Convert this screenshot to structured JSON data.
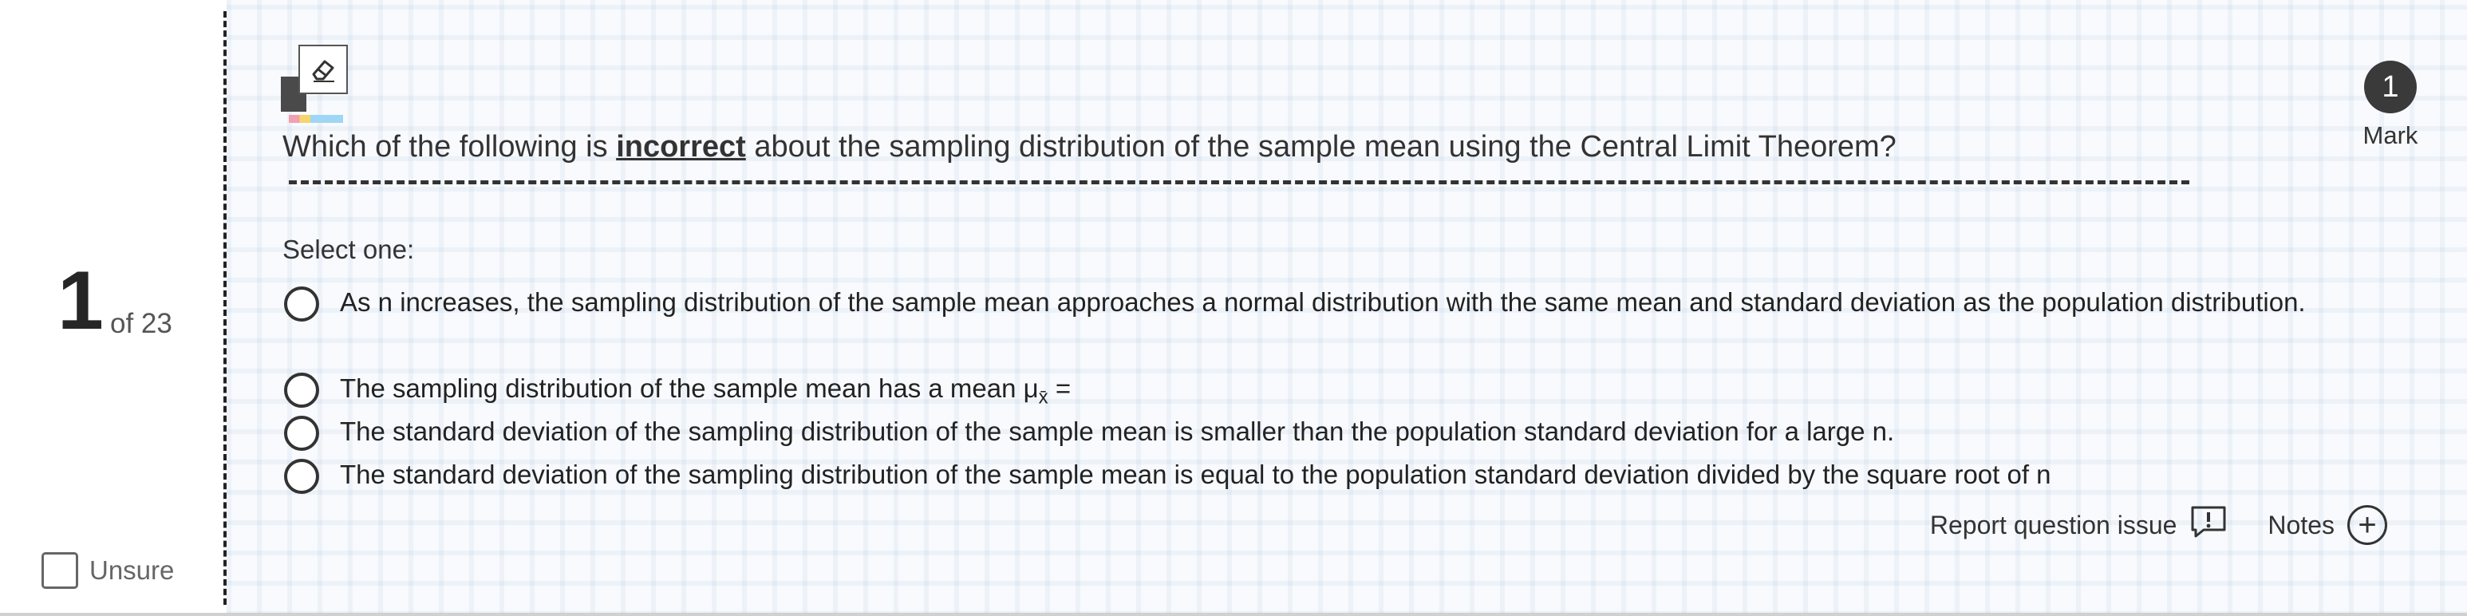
{
  "question_nav": {
    "number": "1",
    "of_total": "of 23"
  },
  "unsure": {
    "label": "Unsure"
  },
  "mark": {
    "value": "1",
    "label": "Mark"
  },
  "question": {
    "prefix": "Which of the following is ",
    "emphasis": "incorrect",
    "suffix": " about the sampling distribution of the sample mean using the Central Limit Theorem?"
  },
  "select_label": "Select one:",
  "options": [
    {
      "text": "As n increases, the sampling distribution of the sample mean approaches a normal distribution with the same mean and standard deviation as the population distribution."
    },
    {
      "text": "The sampling distribution of the sample mean has a mean ",
      "formula_symbol": "μ",
      "formula_sub": "x̄",
      "formula_tail": " ="
    },
    {
      "text": "The standard deviation of the sampling distribution of the sample mean is smaller than the population standard deviation for a large n."
    },
    {
      "text": "The standard deviation of the sampling distribution of the sample mean is equal to the population standard deviation divided by the square root of n"
    }
  ],
  "footer": {
    "report_label": "Report question issue",
    "notes_label": "Notes"
  },
  "icons": {
    "eraser": "eraser-icon",
    "report": "report-issue-icon",
    "notes": "plus-circle-icon"
  }
}
